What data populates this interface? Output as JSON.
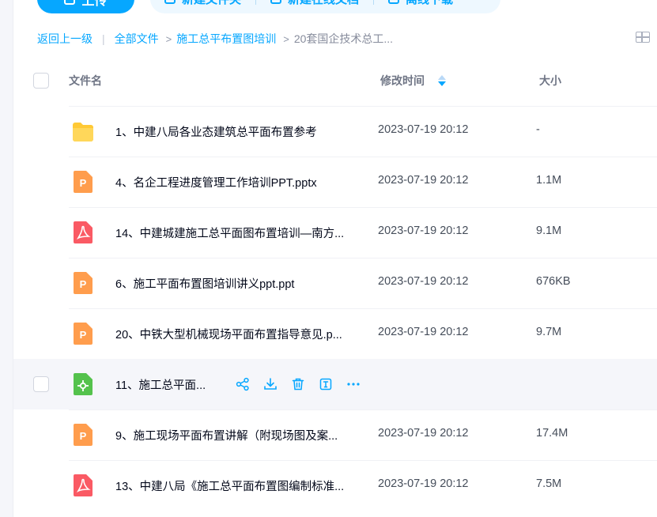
{
  "toolbar": {
    "upload_label": "上传",
    "new_folder_label": "新建文件夹",
    "new_online_doc_label": "新建在线文档",
    "offline_download_label": "离线下载"
  },
  "breadcrumb": {
    "back": "返回上一级",
    "all_files": "全部文件",
    "folder": "施工总平布置图培训",
    "current": "20套国企技术总工..."
  },
  "columns": {
    "name": "文件名",
    "modified": "修改时间",
    "size": "大小"
  },
  "files": [
    {
      "name": "1、中建八局各业态建筑总平面布置参考",
      "time": "2023-07-19 20:12",
      "size": "-",
      "type": "folder"
    },
    {
      "name": "4、名企工程进度管理工作培训PPT.pptx",
      "time": "2023-07-19 20:12",
      "size": "1.1M",
      "type": "ppt"
    },
    {
      "name": "14、中建城建施工总平面图布置培训—南方...",
      "time": "2023-07-19 20:12",
      "size": "9.1M",
      "type": "pdf"
    },
    {
      "name": "6、施工平面布置图培训讲义ppt.ppt",
      "time": "2023-07-19 20:12",
      "size": "676KB",
      "type": "ppt"
    },
    {
      "name": "20、中铁大型机械现场平面布置指导意见.p...",
      "time": "2023-07-19 20:12",
      "size": "9.7M",
      "type": "ppt"
    },
    {
      "name": "11、施工总平面...",
      "time": "",
      "size": "",
      "type": "cad"
    },
    {
      "name": "9、施工现场平面布置讲解（附现场图及案...",
      "time": "2023-07-19 20:12",
      "size": "17.4M",
      "type": "ppt"
    },
    {
      "name": "13、中建八局《施工总平面布置图编制标准...",
      "time": "2023-07-19 20:12",
      "size": "7.5M",
      "type": "pdf"
    }
  ],
  "colors": {
    "accent": "#06a7ff",
    "folder": "#ffc935",
    "ppt": "#ff9d4d",
    "pdf": "#fa5a64",
    "cad": "#54c24c"
  },
  "row_actions": [
    "share-icon",
    "download-icon",
    "delete-icon",
    "rename-icon",
    "more-icon"
  ]
}
